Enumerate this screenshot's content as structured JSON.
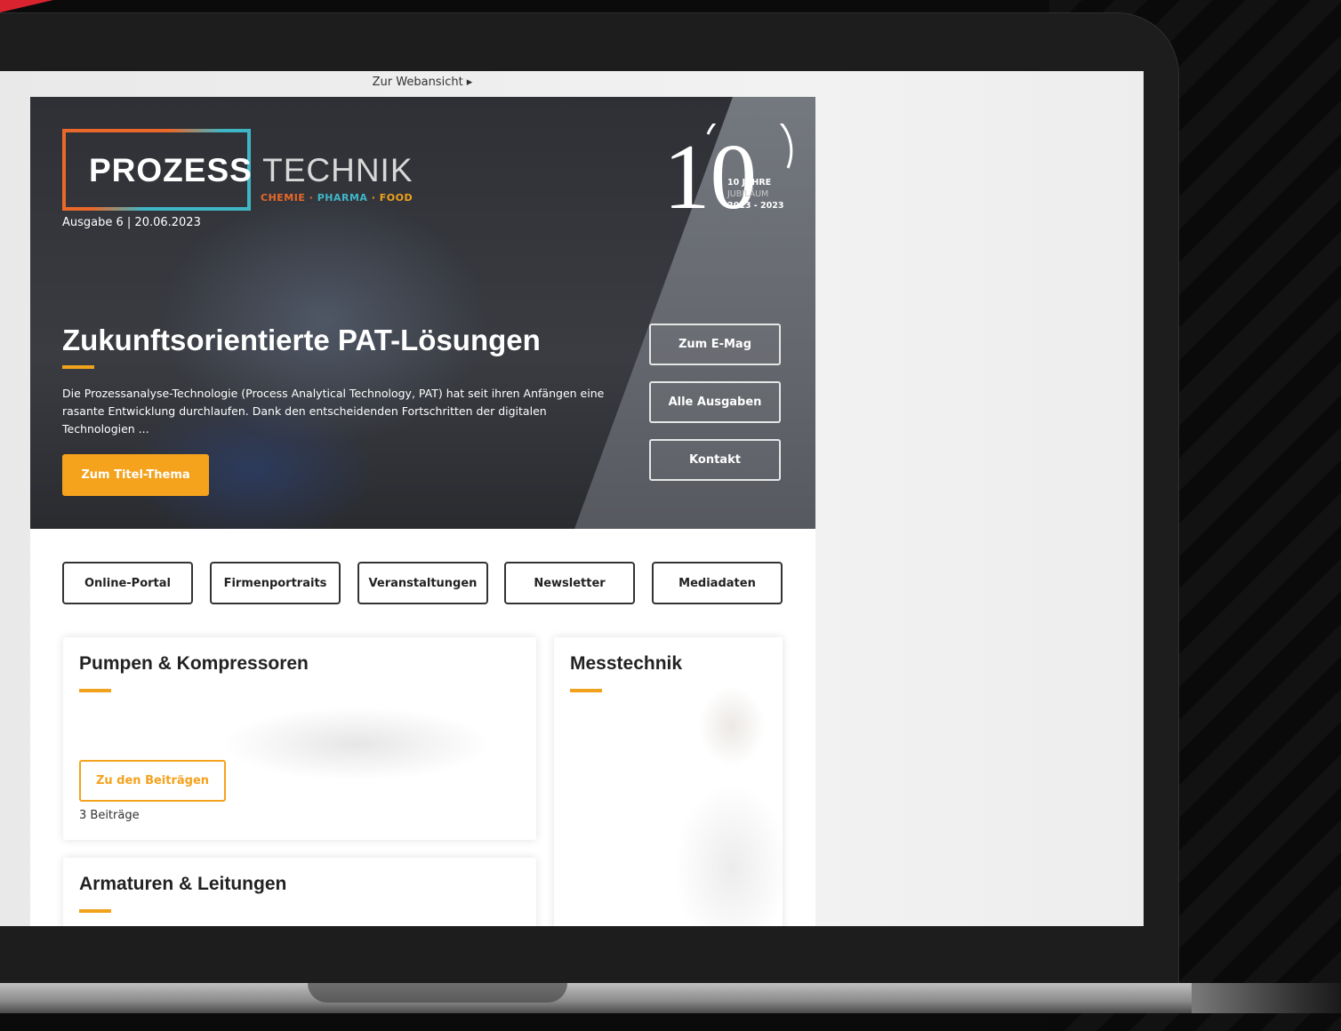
{
  "browser": {
    "webview_link": "Zur Webansicht ▸"
  },
  "hero": {
    "logo_bold": "PROZESS",
    "logo_thin": "TECHNIK",
    "logo_sub": {
      "a": "CHEMIE",
      "b": "PHARMA",
      "c": "FOOD",
      "sep": " · "
    },
    "issue": "Ausgabe 6 | 20.06.2023",
    "jubilee": {
      "line1": "10 JAHRE",
      "line2": "JUBILÄUM",
      "line3": "2013 - 2023",
      "numeral": "10"
    },
    "headline": "Zukunftsorientierte PAT-Lösungen",
    "teaser": "Die Prozessanalyse-Technologie (Process Analytical Technology, PAT) hat seit ihren Anfängen eine rasante Entwicklung durchlaufen. Dank den entscheidenden Fortschritten der digitalen Technologien ...",
    "cta": "Zum Titel-Thema",
    "side_buttons": [
      "Zum E-Mag",
      "Alle Ausgaben",
      "Kontakt"
    ]
  },
  "nav": [
    "Online-Portal",
    "Firmenportraits",
    "Veranstaltungen",
    "Newsletter",
    "Mediadaten"
  ],
  "cards": {
    "pumps": {
      "title": "Pumpen & Kompressoren",
      "button": "Zu den Beiträgen",
      "count": "3 Beiträge"
    },
    "messtechnik": {
      "title": "Messtechnik"
    },
    "armaturen": {
      "title": "Armaturen & Leitungen"
    }
  },
  "colors": {
    "accent": "#f5a21d",
    "logo_orange": "#e9682a",
    "logo_teal": "#3fb6c6",
    "brand_red": "#d9232e"
  }
}
